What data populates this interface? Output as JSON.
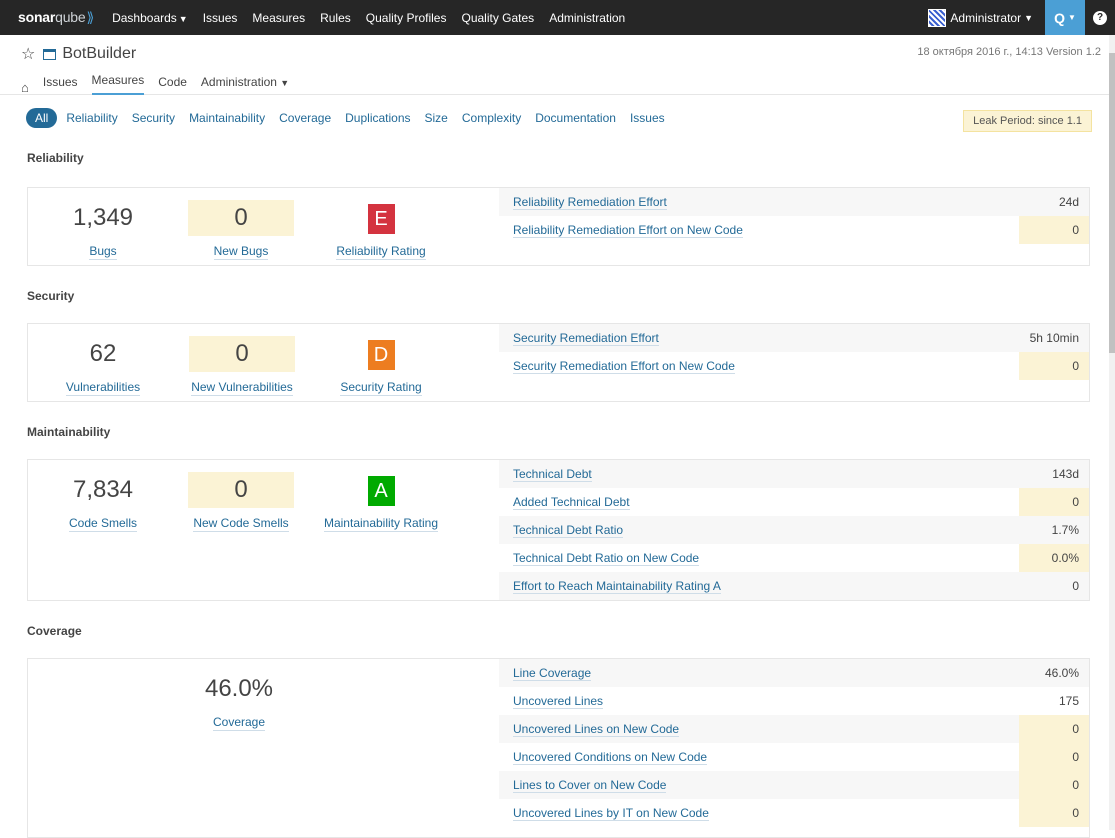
{
  "navbar": {
    "logo_bold": "sonar",
    "logo_light": "qube",
    "items": [
      "Dashboards",
      "Issues",
      "Measures",
      "Rules",
      "Quality Profiles",
      "Quality Gates",
      "Administration"
    ],
    "user": "Administrator",
    "search_icon": "search-icon",
    "help_icon": "?"
  },
  "project": {
    "name": "BotBuilder",
    "meta": "18 октября 2016 г., 14:13  Version 1.2",
    "subnav": [
      "Issues",
      "Measures",
      "Code",
      "Administration"
    ]
  },
  "filters": {
    "active": "All",
    "items": [
      "Reliability",
      "Security",
      "Maintainability",
      "Coverage",
      "Duplications",
      "Size",
      "Complexity",
      "Documentation",
      "Issues"
    ],
    "leak_period": "Leak Period: since 1.1"
  },
  "sections": {
    "reliability": {
      "title": "Reliability",
      "m1": {
        "value": "1,349",
        "label": "Bugs"
      },
      "m2": {
        "value": "0",
        "label": "New Bugs"
      },
      "m3": {
        "value": "E",
        "label": "Reliability Rating",
        "color": "#d4333f"
      },
      "rows": [
        {
          "name": "Reliability Remediation Effort",
          "value": "24d"
        },
        {
          "name": "Reliability Remediation Effort on New Code",
          "value": "0"
        }
      ]
    },
    "security": {
      "title": "Security",
      "m1": {
        "value": "62",
        "label": "Vulnerabilities"
      },
      "m2": {
        "value": "0",
        "label": "New Vulnerabilities"
      },
      "m3": {
        "value": "D",
        "label": "Security Rating",
        "color": "#ed7d20"
      },
      "rows": [
        {
          "name": "Security Remediation Effort",
          "value": "5h 10min"
        },
        {
          "name": "Security Remediation Effort on New Code",
          "value": "0"
        }
      ]
    },
    "maintainability": {
      "title": "Maintainability",
      "m1": {
        "value": "7,834",
        "label": "Code Smells"
      },
      "m2": {
        "value": "0",
        "label": "New Code Smells"
      },
      "m3": {
        "value": "A",
        "label": "Maintainability Rating",
        "color": "#00aa00"
      },
      "rows": [
        {
          "name": "Technical Debt",
          "value": "143d"
        },
        {
          "name": "Added Technical Debt",
          "value": "0"
        },
        {
          "name": "Technical Debt Ratio",
          "value": "1.7%"
        },
        {
          "name": "Technical Debt Ratio on New Code",
          "value": "0.0%"
        },
        {
          "name": "Effort to Reach Maintainability Rating A",
          "value": "0"
        }
      ]
    },
    "coverage": {
      "title": "Coverage",
      "m1": {
        "value": "46.0%",
        "label": "Coverage"
      },
      "rows": [
        {
          "name": "Line Coverage",
          "value": "46.0%"
        },
        {
          "name": "Uncovered Lines",
          "value": "175"
        },
        {
          "name": "Uncovered Lines on New Code",
          "value": "0"
        },
        {
          "name": "Uncovered Conditions on New Code",
          "value": "0"
        },
        {
          "name": "Lines to Cover on New Code",
          "value": "0"
        },
        {
          "name": "Uncovered Lines by IT on New Code",
          "value": "0"
        }
      ]
    }
  }
}
